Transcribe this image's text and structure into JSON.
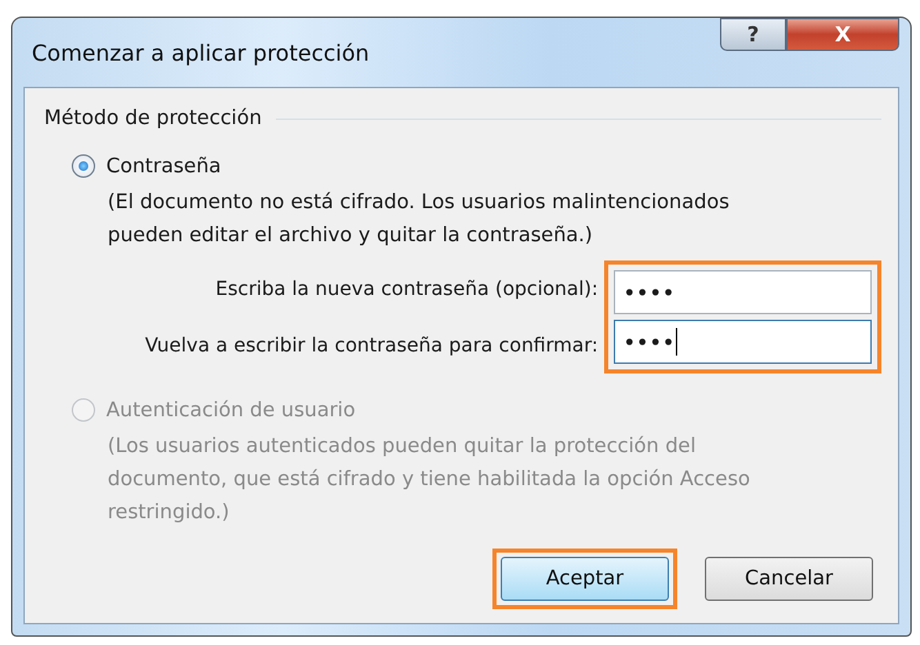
{
  "window": {
    "title": "Comenzar a aplicar protección",
    "help_button": "?",
    "close_button": "X"
  },
  "group": {
    "title": "Método de protección"
  },
  "options": [
    {
      "label": "Contraseña",
      "selected": true,
      "disabled": false,
      "description": "(El documento no está cifrado. Los usuarios malintencionados pueden editar el archivo y quitar la contraseña.)"
    },
    {
      "label": "Autenticación de usuario",
      "selected": false,
      "disabled": true,
      "description": "(Los usuarios autenticados pueden quitar la protección del documento, que está cifrado y tiene habilitada la opción Acceso restringido.)"
    }
  ],
  "fields_highlighted": true,
  "fields": [
    {
      "label": "Escriba la nueva contraseña (opcional):",
      "value": "••••",
      "focused": false
    },
    {
      "label": "Vuelva a escribir la contraseña para confirmar:",
      "value": "••••",
      "focused": true
    }
  ],
  "buttons": [
    {
      "label": "Aceptar",
      "default": true,
      "highlighted": true
    },
    {
      "label": "Cancelar",
      "default": false,
      "highlighted": false
    }
  ]
}
